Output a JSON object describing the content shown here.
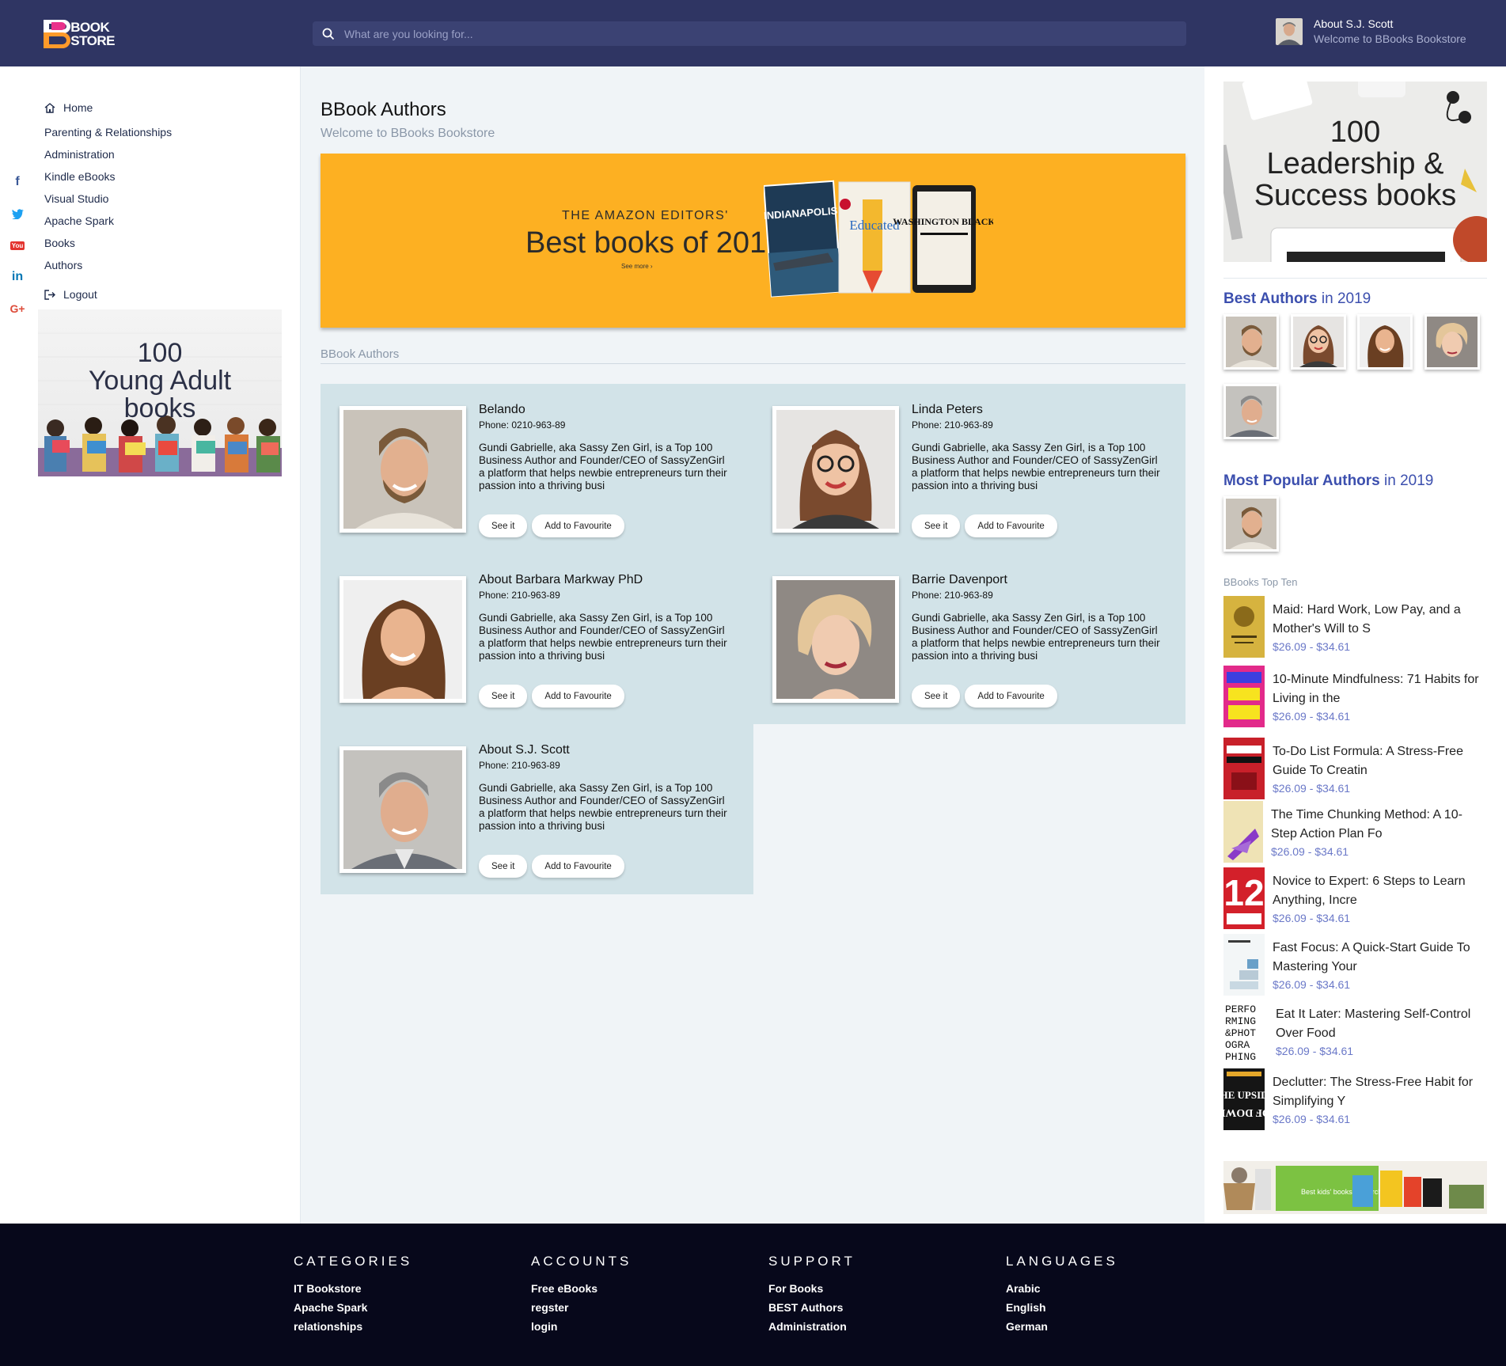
{
  "brand": {
    "line1": "BOOK",
    "line2": "STORE"
  },
  "search": {
    "placeholder": "What are you looking for..."
  },
  "user": {
    "name": "About S.J. Scott",
    "subtitle": "Welcome to BBooks Bookstore"
  },
  "social": {
    "icons": [
      "facebook-icon",
      "twitter-icon",
      "youtube-icon",
      "linkedin-icon",
      "google-plus-icon"
    ],
    "youtube_label": "You",
    "linkedin_label": "in",
    "gplus_label": "G+",
    "fb_label": "f"
  },
  "nav": {
    "home": "Home",
    "items": [
      "Parenting & Relationships",
      "Administration",
      "Kindle eBooks",
      "Visual Studio",
      "Apache Spark",
      "Books",
      "Authors"
    ],
    "logout": "Logout"
  },
  "promo_left": {
    "line1": "100",
    "line2": "Young Adult",
    "line3": "books"
  },
  "main": {
    "title": "BBook Authors",
    "subtitle": "Welcome to BBooks Bookstore",
    "banner": {
      "kicker": "THE AMAZON EDITORS'",
      "headline": "Best books of 2018",
      "more": "See more ›",
      "book1": "INDIANAPOLIS",
      "book2": "Educated",
      "book3": "WASHINGTON BLACK"
    },
    "section_label": "BBook Authors"
  },
  "authors": [
    {
      "name": "Belando",
      "phone": "Phone: 0210-963-89",
      "bio": "Gundi Gabrielle, aka Sassy Zen Girl, is a Top 100 Business Author and Founder/CEO of SassyZenGirl a platform that helps newbie entrepreneurs turn their passion into a thriving busi",
      "see": "See it",
      "fav": "Add to Favourite"
    },
    {
      "name": "Linda Peters",
      "phone": "Phone: 210-963-89",
      "bio": "Gundi Gabrielle, aka Sassy Zen Girl, is a Top 100 Business Author and Founder/CEO of SassyZenGirl a platform that helps newbie entrepreneurs turn their passion into a thriving busi",
      "see": "See it",
      "fav": "Add to Favourite"
    },
    {
      "name": "About Barbara Markway PhD",
      "phone": "Phone: 210-963-89",
      "bio": "Gundi Gabrielle, aka Sassy Zen Girl, is a Top 100 Business Author and Founder/CEO of SassyZenGirl a platform that helps newbie entrepreneurs turn their passion into a thriving busi",
      "see": "See it",
      "fav": "Add to Favourite"
    },
    {
      "name": "Barrie Davenport",
      "phone": "Phone: 210-963-89",
      "bio": "Gundi Gabrielle, aka Sassy Zen Girl, is a Top 100 Business Author and Founder/CEO of SassyZenGirl a platform that helps newbie entrepreneurs turn their passion into a thriving busi",
      "see": "See it",
      "fav": "Add to Favourite"
    },
    {
      "name": "About S.J. Scott",
      "phone": "Phone: 210-963-89",
      "bio": "Gundi Gabrielle, aka Sassy Zen Girl, is a Top 100 Business Author and Founder/CEO of SassyZenGirl a platform that helps newbie entrepreneurs turn their passion into a thriving busi",
      "see": "See it",
      "fav": "Add to Favourite"
    }
  ],
  "promo_right": {
    "line1": "100",
    "line2": "Leadership &",
    "line3": "Success books"
  },
  "best_authors": {
    "bold": "Best Authors",
    "rest": " in 2019"
  },
  "popular_authors": {
    "bold": "Most Popular Authors",
    "rest": " in 2019"
  },
  "top_ten": {
    "label": "BBooks Top Ten",
    "items": [
      {
        "title": "Maid: Hard Work, Low Pay, and a Mother's Will to S",
        "price": "$26.09 - $34.61"
      },
      {
        "title": "10-Minute Mindfulness: 71 Habits for Living in the",
        "price": "$26.09 - $34.61"
      },
      {
        "title": "To-Do List Formula: A Stress-Free Guide To Creatin",
        "price": "$26.09 - $34.61"
      },
      {
        "title": "The Time Chunking Method: A 10-Step Action Plan Fo",
        "price": "$26.09 - $34.61"
      },
      {
        "title": "Novice to Expert: 6 Steps to Learn Anything, Incre",
        "price": "$26.09 - $34.61"
      },
      {
        "title": "Fast Focus: A Quick-Start Guide To Mastering Your",
        "price": "$26.09 - $34.61"
      },
      {
        "title": "Eat It Later: Mastering Self-Control Over Food",
        "price": "$26.09 - $34.61"
      },
      {
        "title": "Declutter: The Stress-Free Habit for Simplifying Y",
        "price": "$26.09 - $34.61"
      }
    ]
  },
  "kids_banner": {
    "text": "Best kids' books of March"
  },
  "footer": {
    "categories": {
      "heading": "CATEGORIES",
      "links": [
        "IT Bookstore",
        "Apache Spark",
        "relationships"
      ]
    },
    "accounts": {
      "heading": "ACCOUNTS",
      "links": [
        "Free eBooks",
        "regster",
        "login"
      ]
    },
    "support": {
      "heading": "SUPPORT",
      "links": [
        "For Books",
        "BEST Authors",
        "Administration"
      ]
    },
    "languages": {
      "heading": "LANGUAGES",
      "links": [
        "Arabic",
        "English",
        "German"
      ]
    }
  },
  "colors": {
    "header": "#2f3563",
    "accent": "#3c4fae",
    "banner": "#fdb022",
    "cards_bg": "#d2e3e8",
    "footer": "#07081b",
    "price": "#6a78c8"
  }
}
